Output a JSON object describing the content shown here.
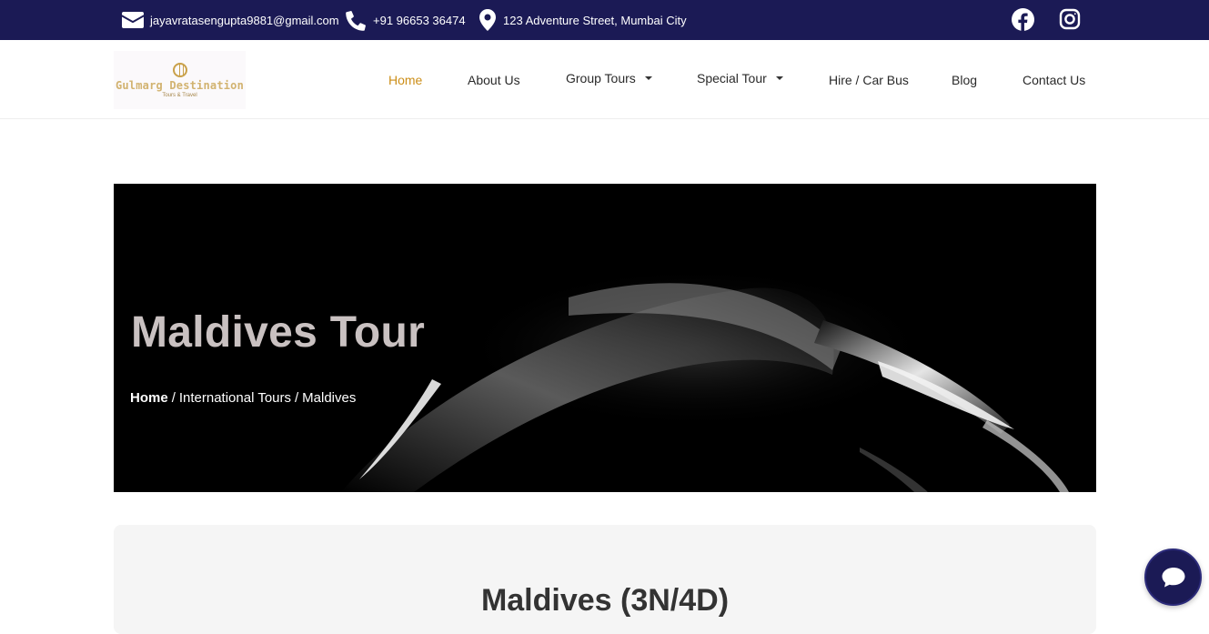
{
  "topbar": {
    "email": "jayavratasengupta9881@gmail.com",
    "phone": "+91 96653 36474",
    "address": "123 Adventure Street, Mumbai City",
    "social": [
      "facebook-icon",
      "instagram-icon"
    ]
  },
  "logo": {
    "title": "Gulmarg Destination",
    "subtitle": "Tours & Travel"
  },
  "nav": {
    "items": [
      {
        "label": "Home",
        "active": true
      },
      {
        "label": "About Us"
      },
      {
        "label": "Group Tours",
        "dropdown": true
      },
      {
        "label": "Special Tour",
        "dropdown": true
      },
      {
        "label": "Hire / Car Bus"
      },
      {
        "label": "Blog"
      },
      {
        "label": "Contact Us"
      }
    ]
  },
  "hero": {
    "title": "Maldives Tour",
    "breadcrumb": {
      "home": "Home",
      "sep": "/",
      "section": "International Tours",
      "current": "Maldives"
    }
  },
  "panel": {
    "title": "Maldives (3N/4D)"
  },
  "colors": {
    "topbar_bg": "#1b1a55",
    "accent": "#cc8e18",
    "hero_bg": "#000000",
    "panel_bg": "#f5f5f5"
  },
  "chat": {
    "icon": "chat-bubble-icon"
  }
}
